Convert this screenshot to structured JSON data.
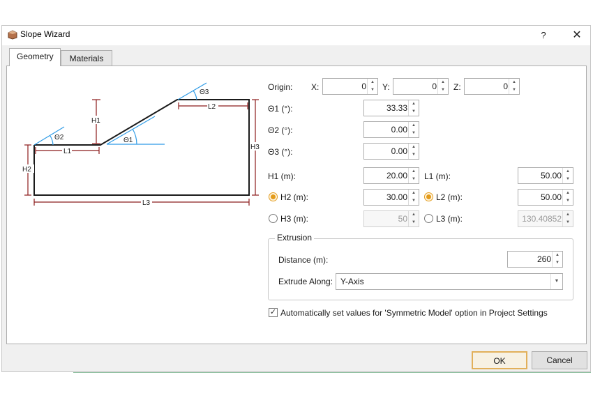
{
  "window": {
    "title": "Slope Wizard",
    "help": "?",
    "close": "✕"
  },
  "tabs": [
    {
      "label": "Geometry",
      "active": true
    },
    {
      "label": "Materials",
      "active": false
    }
  ],
  "diagram": {
    "labels": {
      "t3": "Θ3",
      "l2": "L2",
      "h1": "H1",
      "t2": "Θ2",
      "t1": "Θ1",
      "l1": "L1",
      "h3": "H3",
      "h2": "H2",
      "l3": "L3"
    },
    "colors": {
      "outline": "#1a1a1a",
      "dims": "#8b1a1a",
      "angles": "#2e9be6"
    }
  },
  "origin": {
    "label": "Origin:",
    "x_label": "X:",
    "x": "0",
    "y_label": "Y:",
    "y": "0",
    "z_label": "Z:",
    "z": "0"
  },
  "angles": [
    {
      "label": "Θ1 (°):",
      "value": "33.33"
    },
    {
      "label": "Θ2 (°):",
      "value": "0.00"
    },
    {
      "label": "Θ3 (°):",
      "value": "0.00"
    }
  ],
  "dims": {
    "h1": {
      "label": "H1 (m):",
      "value": "20.00"
    },
    "l1": {
      "label": "L1 (m):",
      "value": "50.00"
    },
    "h2": {
      "label": "H2 (m):",
      "value": "30.00",
      "selected": true
    },
    "l2": {
      "label": "L2 (m):",
      "value": "50.00",
      "selected": true
    },
    "h3": {
      "label": "H3 (m):",
      "value": "50",
      "selected": false
    },
    "l3": {
      "label": "L3 (m):",
      "value": "130.40852",
      "selected": false
    }
  },
  "extrusion": {
    "title": "Extrusion",
    "distance_label": "Distance (m):",
    "distance": "260",
    "along_label": "Extrude Along:",
    "along": "Y-Axis"
  },
  "symmetric": {
    "label": "Automatically set values for 'Symmetric Model' option in Project Settings",
    "checked": true
  },
  "buttons": {
    "ok": "OK",
    "cancel": "Cancel"
  },
  "colors": {
    "accent_radio": "#e39b1b",
    "ok_border": "#e2b05a"
  }
}
